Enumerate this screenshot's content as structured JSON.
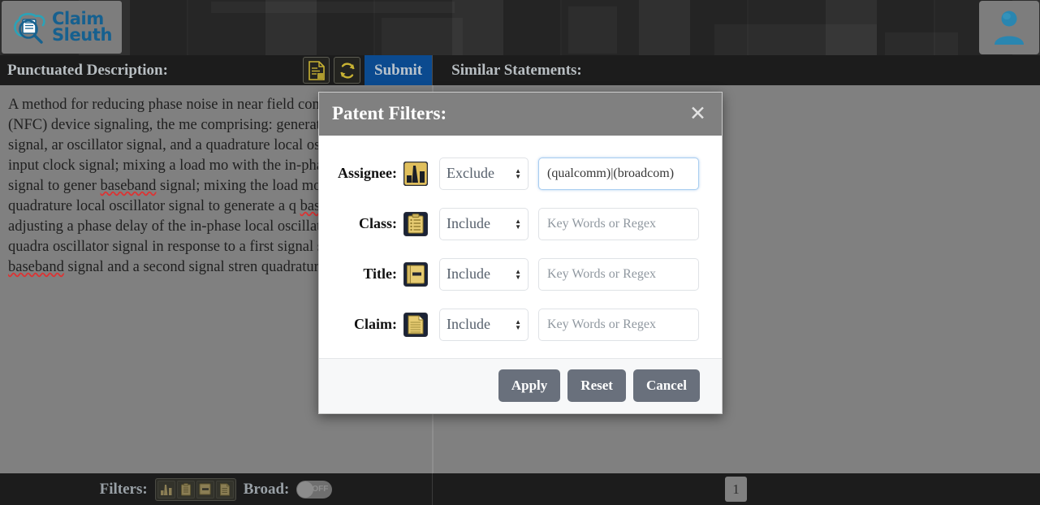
{
  "brand": {
    "line1": "Claim",
    "line2": "Sleuth",
    "color": "#16608f"
  },
  "toolbar": {
    "punctuated_label": "Punctuated Description:",
    "similar_label": "Similar Statements:",
    "submit_label": "Submit",
    "document_icon": "document-lines-icon",
    "refresh_icon": "refresh-icon",
    "submit_color": "#0b4a8f"
  },
  "avatar": {
    "icon": "user-avatar-icon"
  },
  "claim": {
    "text": "A method for reducing phase noise in near field communication (NFC) device signaling, the me comprising: generating a transmission signal, ar oscillator signal, and a quadrature local oscillato edges of an input clock signal; mixing a load mo with the in-phase local oscillator signal to gener baseband signal; mixing the load modulated sig quadrature local oscillator signal to generate a q baseband signal; and adjusting a phase delay of the in-phase local oscillator signal or the quadra oscillator signal in response to a first signal stre phase baseband signal and a second signal stren quadrature baseband signal."
  },
  "modal": {
    "title": "Patent Filters:",
    "close_icon": "close-icon",
    "header_color": "#808080",
    "rows": [
      {
        "label": "Assignee:",
        "icon": "bar-chart-building-icon",
        "select_value": "Exclude",
        "input_value": "(qualcomm)|(broadcom)",
        "input_placeholder": "Key Words or Regex",
        "focused": true
      },
      {
        "label": "Class:",
        "icon": "clipboard-icon",
        "select_value": "Include",
        "input_value": "",
        "input_placeholder": "Key Words or Regex",
        "focused": false
      },
      {
        "label": "Title:",
        "icon": "book-icon",
        "select_value": "Include",
        "input_value": "",
        "input_placeholder": "Key Words or Regex",
        "focused": false
      },
      {
        "label": "Claim:",
        "icon": "document-icon",
        "select_value": "Include",
        "input_value": "",
        "input_placeholder": "Key Words or Regex",
        "focused": false
      }
    ],
    "select_options": [
      "Include",
      "Exclude"
    ],
    "buttons": {
      "apply": "Apply",
      "reset": "Reset",
      "cancel": "Cancel"
    }
  },
  "bottom": {
    "filters_label": "Filters:",
    "broad_label": "Broad:",
    "broad_state": "OFF",
    "filter_icons": [
      "bar-chart-building-icon",
      "clipboard-icon",
      "book-icon",
      "document-icon"
    ],
    "page_number": "1"
  }
}
